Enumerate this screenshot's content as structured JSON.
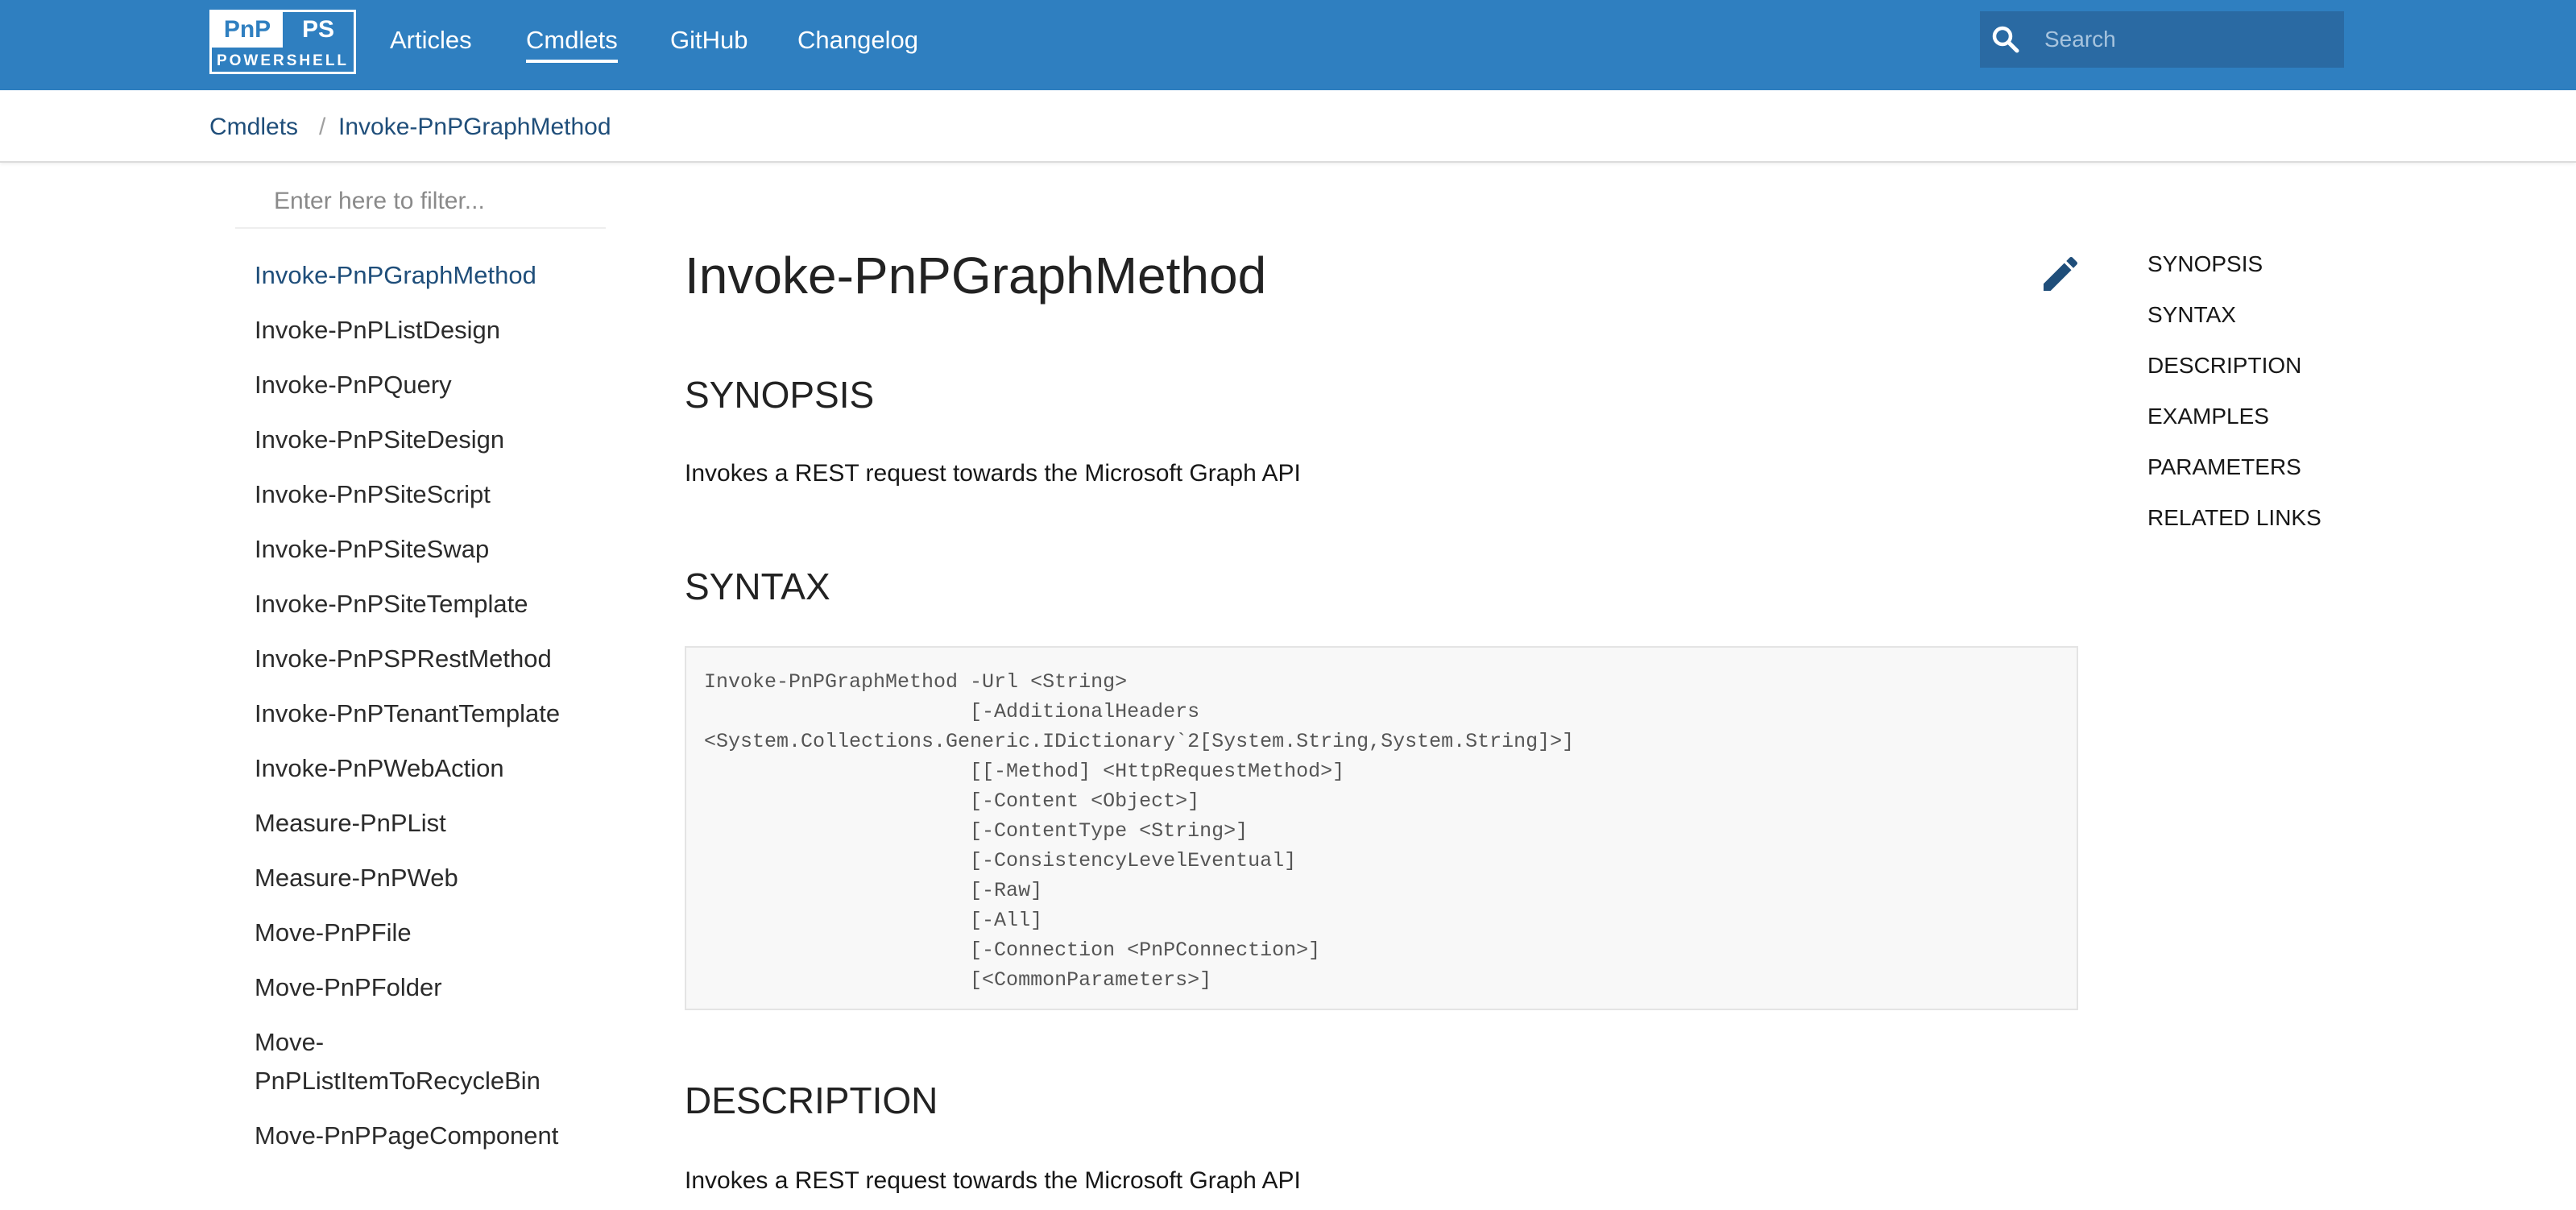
{
  "navbar": {
    "logo": {
      "top_left": "PnP",
      "top_right": "PS",
      "bottom": "POWERSHELL"
    },
    "links": [
      {
        "label": "Articles",
        "active": false
      },
      {
        "label": "Cmdlets",
        "active": true
      },
      {
        "label": "GitHub",
        "active": false
      },
      {
        "label": "Changelog",
        "active": false
      }
    ],
    "search": {
      "placeholder": "Search",
      "value": ""
    }
  },
  "breadcrumb": {
    "items": [
      "Cmdlets",
      "Invoke-PnPGraphMethod"
    ],
    "separator": "/"
  },
  "sidebar": {
    "filter": {
      "placeholder": "Enter here to filter...",
      "value": ""
    },
    "items": [
      "Invoke-PnPGraphMethod",
      "Invoke-PnPListDesign",
      "Invoke-PnPQuery",
      "Invoke-PnPSiteDesign",
      "Invoke-PnPSiteScript",
      "Invoke-PnPSiteSwap",
      "Invoke-PnPSiteTemplate",
      "Invoke-PnPSPRestMethod",
      "Invoke-PnPTenantTemplate",
      "Invoke-PnPWebAction",
      "Measure-PnPList",
      "Measure-PnPWeb",
      "Move-PnPFile",
      "Move-PnPFolder",
      "Move-PnPListItemToRecycleBin",
      "Move-PnPPageComponent"
    ],
    "active_index": 0
  },
  "main": {
    "title": "Invoke-PnPGraphMethod",
    "edit_icon": "pencil-icon",
    "synopsis_heading": "SYNOPSIS",
    "synopsis_text": "Invokes a REST request towards the Microsoft Graph API",
    "syntax_heading": "SYNTAX",
    "syntax_code": "Invoke-PnPGraphMethod -Url <String>\n                      [-AdditionalHeaders\n<System.Collections.Generic.IDictionary`2[System.String,System.String]>]\n                      [[-Method] <HttpRequestMethod>]\n                      [-Content <Object>]\n                      [-ContentType <String>]\n                      [-ConsistencyLevelEventual]\n                      [-Raw]\n                      [-All]\n                      [-Connection <PnPConnection>]\n                      [<CommonParameters>]",
    "description_heading": "DESCRIPTION",
    "description_text": "Invokes a REST request towards the Microsoft Graph API"
  },
  "toc": {
    "items": [
      "SYNOPSIS",
      "SYNTAX",
      "DESCRIPTION",
      "EXAMPLES",
      "PARAMETERS",
      "RELATED LINKS"
    ]
  },
  "colors": {
    "navbar": "#2f7fc0",
    "search_bg": "#2a6aa3",
    "link": "#1f4e7a",
    "code_bg": "#f8f8f8"
  }
}
